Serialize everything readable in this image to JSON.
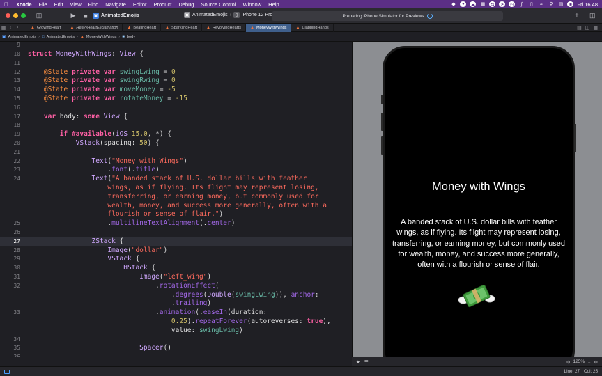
{
  "menubar": {
    "app": "Xcode",
    "items": [
      "File",
      "Edit",
      "View",
      "Find",
      "Navigate",
      "Editor",
      "Product",
      "Debug",
      "Source Control",
      "Window",
      "Help"
    ],
    "clock": "Fri 16.48"
  },
  "toolbar": {
    "project": "AnimatedEmojis",
    "scheme": "AnimatedEmojis",
    "device": "iPhone 12 Pro",
    "status": "Preparing iPhone Simulator for Previews"
  },
  "tabs": [
    {
      "label": "GrowingHeart",
      "active": false
    },
    {
      "label": "HeavyHeartExclamation",
      "active": false
    },
    {
      "label": "BeatingHeart",
      "active": false
    },
    {
      "label": "SparklingHeart",
      "active": false
    },
    {
      "label": "RevolvingHearts",
      "active": false
    },
    {
      "label": "MoneyWithWings",
      "active": true
    },
    {
      "label": "ClappingHands",
      "active": false
    }
  ],
  "breadcrumb": {
    "project": "AnimatedEmojis",
    "folder": "AnimatedEmojis",
    "file": "MoneyWithWings",
    "symbol": "body"
  },
  "editor": {
    "current_line": "27",
    "lines": [
      {
        "n": "9",
        "html": ""
      },
      {
        "n": "10",
        "html": "<span class=\"kw\">struct</span> <span class=\"ty\">MoneyWithWings</span>: <span class=\"ty\">View</span> {"
      },
      {
        "n": "11",
        "html": ""
      },
      {
        "n": "12",
        "html": "    <span class=\"at\">@State</span> <span class=\"kw\">private var</span> <span class=\"vr\">swingLwing</span> = <span class=\"nm\">0</span>"
      },
      {
        "n": "13",
        "html": "    <span class=\"at\">@State</span> <span class=\"kw\">private var</span> <span class=\"vr\">swingRwing</span> = <span class=\"nm\">0</span>"
      },
      {
        "n": "14",
        "html": "    <span class=\"at\">@State</span> <span class=\"kw\">private var</span> <span class=\"vr\">moveMoney</span> = <span class=\"nm\">-5</span>"
      },
      {
        "n": "15",
        "html": "    <span class=\"at\">@State</span> <span class=\"kw\">private var</span> <span class=\"vr\">rotateMoney</span> = <span class=\"nm\">-15</span>"
      },
      {
        "n": "16",
        "html": ""
      },
      {
        "n": "17",
        "html": "    <span class=\"kw\">var</span> body: <span class=\"kw\">some</span> <span class=\"ty\">View</span> {"
      },
      {
        "n": "18",
        "html": ""
      },
      {
        "n": "19",
        "html": "        <span class=\"kw\">if</span> <span class=\"kw\">#available</span>(<span class=\"ty\">iOS</span> <span class=\"nm\">15.0</span>, *) {"
      },
      {
        "n": "20",
        "html": "            <span class=\"ty\">VStack</span>(spacing: <span class=\"nm\">50</span>) {"
      },
      {
        "n": "21",
        "html": ""
      },
      {
        "n": "22",
        "html": "                <span class=\"ty\">Text</span>(<span class=\"st\">\"Money with Wings\"</span>)"
      },
      {
        "n": "23",
        "html": "                    .<span class=\"fn\">font</span>(.<span class=\"fn\">title</span>)"
      },
      {
        "n": "24",
        "html": "                <span class=\"ty\">Text</span>(<span class=\"st\">\"A banded stack of U.S. dollar bills with feather</span>"
      },
      {
        "n": "",
        "html": "<span class=\"st\">                    wings, as if flying. Its flight may represent losing,</span>"
      },
      {
        "n": "",
        "html": "<span class=\"st\">                    transferring, or earning money, but commonly used for</span>"
      },
      {
        "n": "",
        "html": "<span class=\"st\">                    wealth, money, and success more generally, often with a</span>"
      },
      {
        "n": "",
        "html": "<span class=\"st\">                    flourish or sense of flair.\"</span>)"
      },
      {
        "n": "25",
        "html": "                    .<span class=\"fn\">multilineTextAlignment</span>(.<span class=\"fn\">center</span>)"
      },
      {
        "n": "26",
        "html": ""
      },
      {
        "n": "27",
        "html": "                <span class=\"ty\">ZStack</span> {"
      },
      {
        "n": "28",
        "html": "                    <span class=\"ty\">Image</span>(<span class=\"st\">\"dollar\"</span>)"
      },
      {
        "n": "29",
        "html": "                    <span class=\"ty\">VStack</span> {"
      },
      {
        "n": "30",
        "html": "                        <span class=\"ty\">HStack</span> {"
      },
      {
        "n": "31",
        "html": "                            <span class=\"ty\">Image</span>(<span class=\"st\">\"left_wing\"</span>)"
      },
      {
        "n": "32",
        "html": "                                .<span class=\"fn\">rotationEffect</span>("
      },
      {
        "n": "",
        "html": "                                    .<span class=\"fn\">degrees</span>(<span class=\"ty\">Double</span>(<span class=\"vr\">swingLwing</span>)), <span class=\"fn\">anchor</span>:"
      },
      {
        "n": "",
        "html": "                                    .<span class=\"fn\">trailing</span>)"
      },
      {
        "n": "33",
        "html": "                                .<span class=\"fn\">animation</span>(.<span class=\"fn\">easeIn</span>(duration:"
      },
      {
        "n": "",
        "html": "                                    <span class=\"nm\">0.25</span>).<span class=\"fn\">repeatForever</span>(autoreverses: <span class=\"kw\">true</span>),"
      },
      {
        "n": "",
        "html": "                                    value: <span class=\"vr\">swingLwing</span>)"
      },
      {
        "n": "34",
        "html": ""
      },
      {
        "n": "35",
        "html": "                            <span class=\"ty\">Spacer</span>()"
      },
      {
        "n": "36",
        "html": ""
      }
    ]
  },
  "preview": {
    "title": "Money with Wings",
    "description": "A banded stack of U.S. dollar bills with feather wings, as if flying. Its flight may represent losing, transferring, or earning money, but commonly used for wealth, money, and success more generally, often with a flourish or sense of flair.",
    "zoom": "125%"
  },
  "statusbar": {
    "line": "Line: 27",
    "col": "Col: 25"
  },
  "colors": {
    "menubar": "#5b2f86",
    "active_tab": "#3f5f8c",
    "keyword": "#fc5fa3",
    "string": "#fc6a5d",
    "number": "#d0bf69",
    "type": "#d0a8ff"
  }
}
